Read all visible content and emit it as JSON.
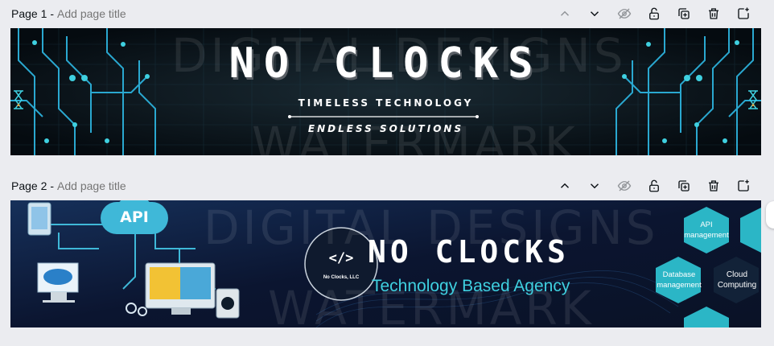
{
  "pages": [
    {
      "label": "Page 1",
      "separator": "-",
      "title_placeholder": "Add page title",
      "banner": {
        "headline": "NO CLOCKS",
        "tagline_top": "TIMELESS TECHNOLOGY",
        "tagline_bottom": "ENDLESS SOLUTIONS",
        "watermark_top": "DIGITAL DESIGNS",
        "watermark_bottom": "WATERMARK"
      }
    },
    {
      "label": "Page 2",
      "separator": "-",
      "title_placeholder": "Add page title",
      "banner": {
        "cloud_label": "API",
        "logo_caption": "No Clocks, LLC",
        "logo_symbol": "</>",
        "headline": "NO CLOCKS",
        "subheadline": "Technology Based Agency",
        "hex_items": [
          "API management",
          "Database management",
          "Cloud Computing"
        ],
        "watermark_top": "DIGITAL DESIGNS",
        "watermark_bottom": "WATERMARK"
      }
    }
  ],
  "toolbar_icons": [
    "chevron-up-icon",
    "chevron-down-icon",
    "eye-off-icon",
    "lock-open-icon",
    "duplicate-icon",
    "trash-icon",
    "add-page-icon"
  ],
  "colors": {
    "accent_cyan": "#3fd0e0",
    "hex_teal": "#2bb6c6",
    "headline_white": "#ffffff",
    "workspace_bg": "#ebecf0"
  }
}
